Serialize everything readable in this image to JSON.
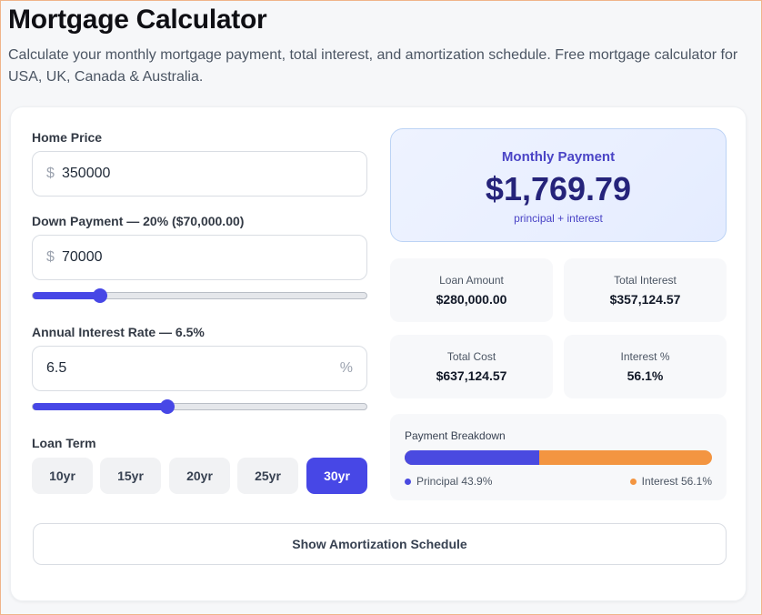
{
  "header": {
    "title": "Mortgage Calculator",
    "description": "Calculate your monthly mortgage payment, total interest, and amortization schedule. Free mortgage calculator for USA, UK, Canada & Australia."
  },
  "inputs": {
    "home_price": {
      "label": "Home Price",
      "prefix": "$",
      "value": "350000"
    },
    "down_payment": {
      "label": "Down Payment — 20% ($70,000.00)",
      "prefix": "$",
      "value": "70000",
      "slider_fraction": 0.2
    },
    "interest_rate": {
      "label": "Annual Interest Rate — 6.5%",
      "value": "6.5",
      "suffix": "%",
      "slider_fraction": 0.4
    },
    "loan_term": {
      "label": "Loan Term",
      "options": [
        "10yr",
        "15yr",
        "20yr",
        "25yr",
        "30yr"
      ],
      "selected": "30yr"
    }
  },
  "results": {
    "monthly_payment": {
      "label": "Monthly Payment",
      "value": "$1,769.79",
      "sub": "principal + interest"
    },
    "loan_amount": {
      "label": "Loan Amount",
      "value": "$280,000.00"
    },
    "total_interest": {
      "label": "Total Interest",
      "value": "$357,124.57"
    },
    "total_cost": {
      "label": "Total Cost",
      "value": "$637,124.57"
    },
    "interest_pct": {
      "label": "Interest %",
      "value": "56.1%"
    },
    "breakdown": {
      "title": "Payment Breakdown",
      "principal_label": "Principal 43.9%",
      "interest_label": "Interest 56.1%",
      "principal_fraction": 0.439
    }
  },
  "actions": {
    "amortization_label": "Show Amortization Schedule"
  },
  "colors": {
    "accent": "#4747e6",
    "interest": "#f39541",
    "principal": "#4a4ae0"
  }
}
